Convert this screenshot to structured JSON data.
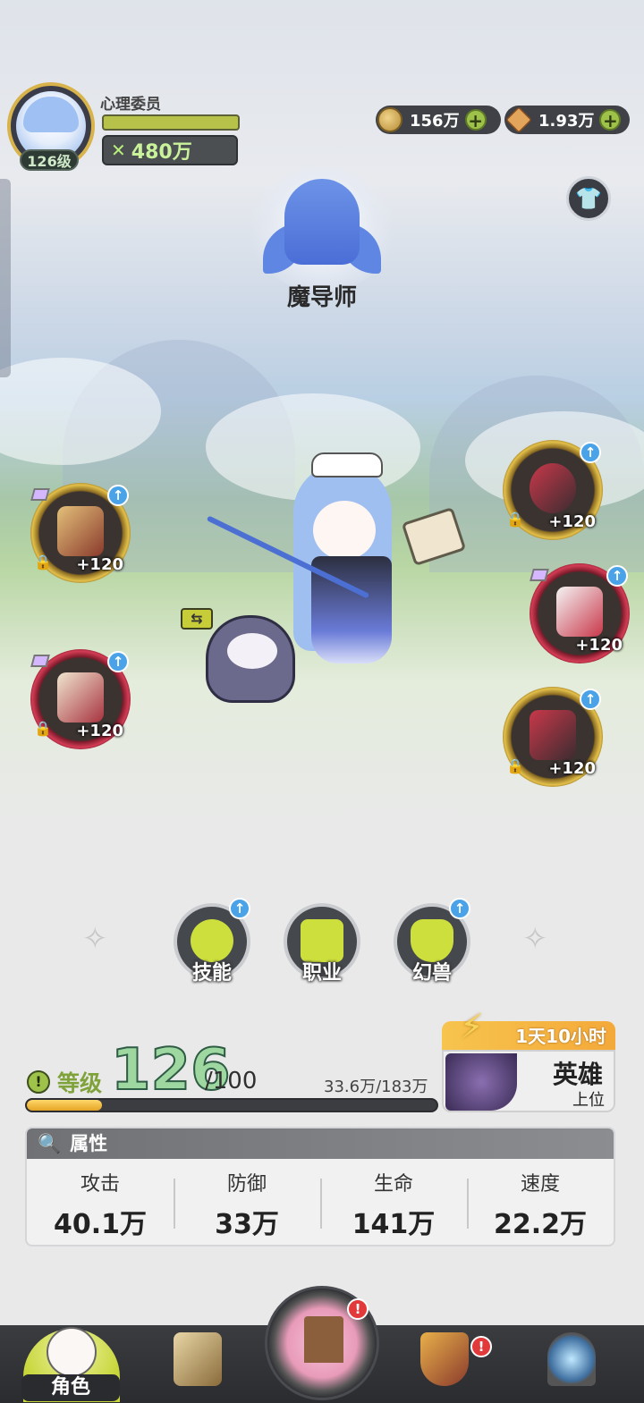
{
  "player": {
    "name": "心理委员",
    "level_badge": "126级",
    "power_icon": "crossed-swords-icon",
    "power": "480万"
  },
  "currency": {
    "coins": "156万",
    "gems": "1.93万",
    "plus": "+"
  },
  "class": {
    "name": "魔导师"
  },
  "pet": {
    "swap_label": "⇆"
  },
  "equipment": {
    "slots": [
      {
        "name": "weapon",
        "enhance": "+120",
        "frame": "gold"
      },
      {
        "name": "tome",
        "enhance": "+120",
        "frame": "red"
      },
      {
        "name": "accessory",
        "enhance": "+120",
        "frame": "gold"
      },
      {
        "name": "armor",
        "enhance": "+120",
        "frame": "red"
      },
      {
        "name": "boots",
        "enhance": "+120",
        "frame": "gold"
      }
    ],
    "upgrade_glyph": "↑",
    "lock_glyph": "🔒"
  },
  "skills": [
    {
      "label": "技能",
      "has_upgrade": true
    },
    {
      "label": "职业",
      "has_upgrade": false
    },
    {
      "label": "幻兽",
      "has_upgrade": true
    }
  ],
  "level": {
    "warn": "!",
    "label": "等级",
    "value": "126",
    "max": "/100",
    "exp": "33.6万/183万",
    "progress_fraction": 0.184
  },
  "hero": {
    "timer": "1天10小时",
    "rank": "英雄",
    "sub": "上位"
  },
  "attributes": {
    "title": "属性",
    "search_icon": "search-icon",
    "items": [
      {
        "name": "攻击",
        "value": "40.1万"
      },
      {
        "name": "防御",
        "value": "33万"
      },
      {
        "name": "生命",
        "value": "141万"
      },
      {
        "name": "速度",
        "value": "22.2万"
      }
    ]
  },
  "nav": {
    "active_label": "角色",
    "badge": "!"
  },
  "colors": {
    "accent_green": "#9ec14a",
    "gold_frame": "#e3c04a",
    "red_frame": "#d43c55",
    "upgrade_blue": "#4aa3e8",
    "timer_orange": "#f4a939"
  }
}
